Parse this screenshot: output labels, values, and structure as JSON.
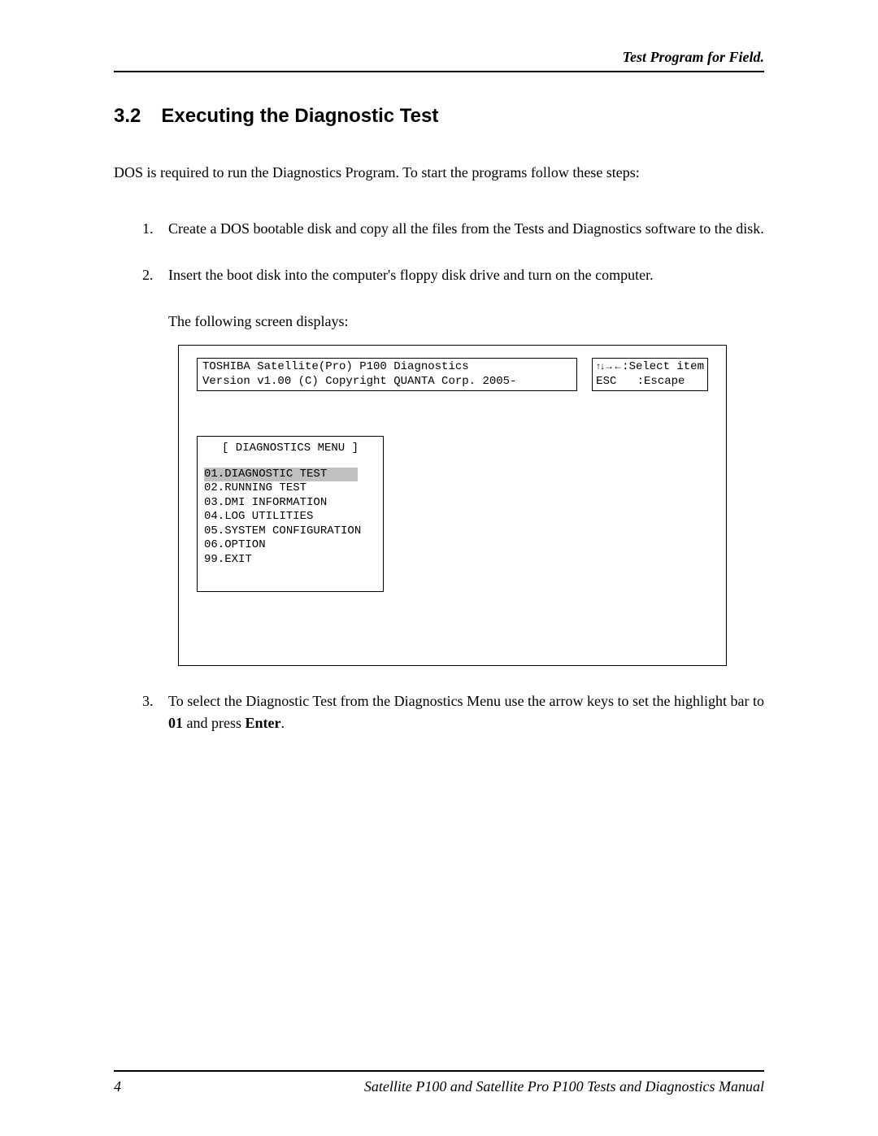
{
  "header": {
    "running_title": "Test Program for Field."
  },
  "section": {
    "number": "3.2",
    "title": "Executing the Diagnostic Test"
  },
  "intro": "DOS is required to run the Diagnostics Program. To start the programs follow these steps:",
  "steps": {
    "s1": {
      "num": "1.",
      "text": "Create a DOS bootable disk and copy all the files from the Tests and Diagnostics software to the disk."
    },
    "s2": {
      "num": "2.",
      "text": "Insert the boot disk into the computer's floppy disk drive and turn on the computer.",
      "following": "The following screen displays:"
    },
    "s3": {
      "num": "3.",
      "pre": "To select the Diagnostic Test from the Diagnostics Menu use the arrow keys to set the highlight bar to ",
      "bold1": "01",
      "mid": " and press ",
      "bold2": "Enter",
      "post": "."
    }
  },
  "screen": {
    "version_line1": "TOSHIBA Satellite(Pro) P100 Diagnostics",
    "version_line2": "Version v1.00 (C) Copyright QUANTA Corp. 2005-",
    "hint_select": ":Select item",
    "hint_esc1": "ESC",
    "hint_esc2": ":Escape",
    "menu_title": "[ DIAGNOSTICS MENU ]",
    "items": {
      "i1": "01.DIAGNOSTIC TEST",
      "i2": "02.RUNNING TEST",
      "i3": "03.DMI INFORMATION",
      "i4": "04.LOG UTILITIES",
      "i5": "05.SYSTEM CONFIGURATION",
      "i6": "06.OPTION",
      "i7": "99.EXIT"
    }
  },
  "footer": {
    "page": "4",
    "title": "Satellite P100 and Satellite Pro P100 Tests and Diagnostics Manual"
  }
}
